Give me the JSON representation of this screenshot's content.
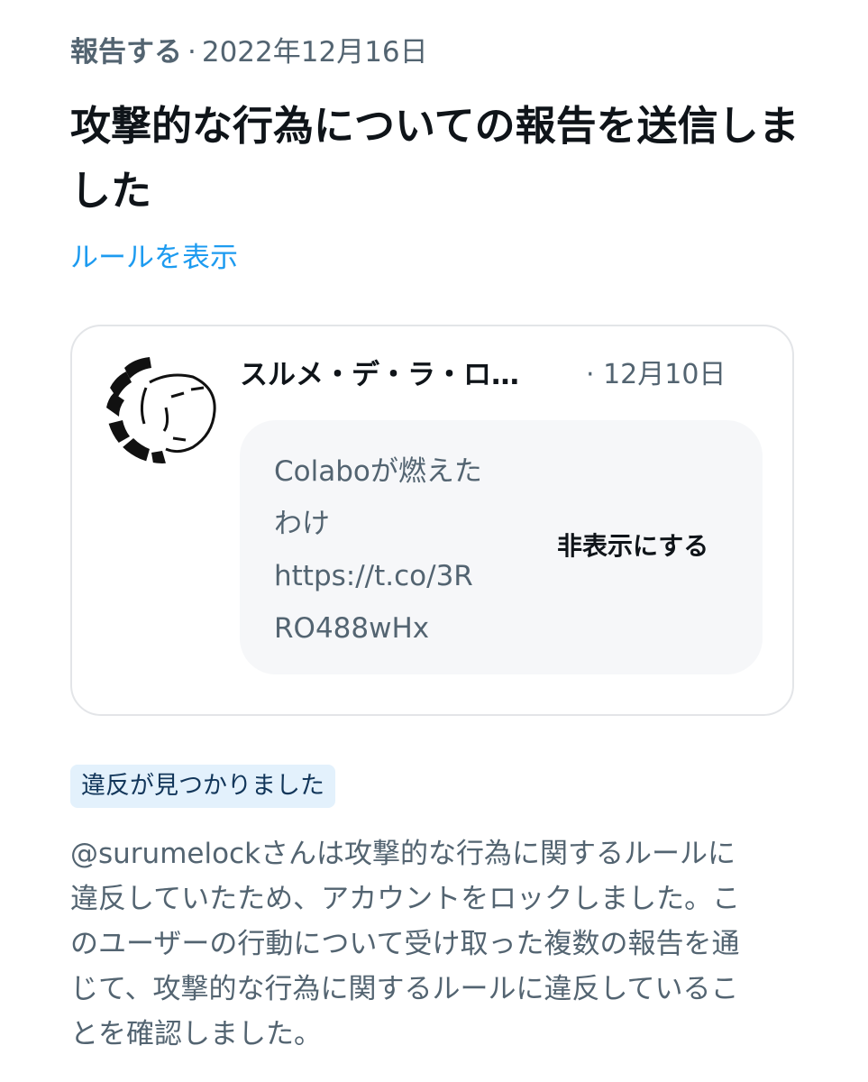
{
  "meta": {
    "category": "報告する",
    "separator": "·",
    "date": "2022年12月16日"
  },
  "title": "攻撃的な行為についての報告を送信しました",
  "rules_link": "ルールを表示",
  "reported_tweet": {
    "author_name": "スルメ・デ・ラ・ロ…",
    "date": "· 12月10日",
    "text_lines": [
      "Colaboが燃えた",
      "わけ",
      "https://t.co/3R",
      "RO488wHx"
    ],
    "hide_label": "非表示にする",
    "avatar_icon": "user-avatar-drawing"
  },
  "violation_badge": "違反が見つかりました",
  "description_lines": [
    "@surumelockさんは攻撃的な行為に関するルールに",
    "違反していたため、アカウントをロックしました。こ",
    "のユーザーの行動について受け取った複数の報告を通",
    "じて、攻撃的な行為に関するルールに違反しているこ",
    "とを確認しました。"
  ],
  "colors": {
    "link": "#1d9bf0",
    "badge_bg": "#e3f1fc",
    "muted_text": "#536471"
  }
}
